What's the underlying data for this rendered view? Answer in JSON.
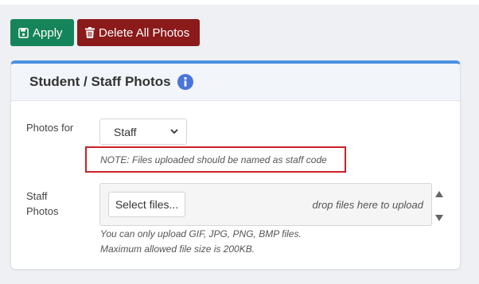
{
  "toolbar": {
    "apply_label": "Apply",
    "delete_label": "Delete All Photos"
  },
  "panel": {
    "title": "Student / Staff Photos",
    "photos_for_label": "Photos for",
    "photos_for_value": "Staff",
    "note": "NOTE: Files uploaded should be named as staff code",
    "staff_photos_label": "Staff Photos",
    "select_files_label": "Select files...",
    "drop_hint": "drop files here to upload",
    "file_types_hint": "You can only upload GIF, JPG, PNG, BMP files.",
    "size_hint": "Maximum allowed file size is 200KB."
  },
  "colors": {
    "apply": "#16845a",
    "delete": "#8b1a1a",
    "accent": "#4a90e2",
    "highlight": "#cc2027"
  },
  "icons": {
    "apply": "floppy-disk-icon",
    "delete": "trash-icon",
    "info": "info-icon"
  }
}
